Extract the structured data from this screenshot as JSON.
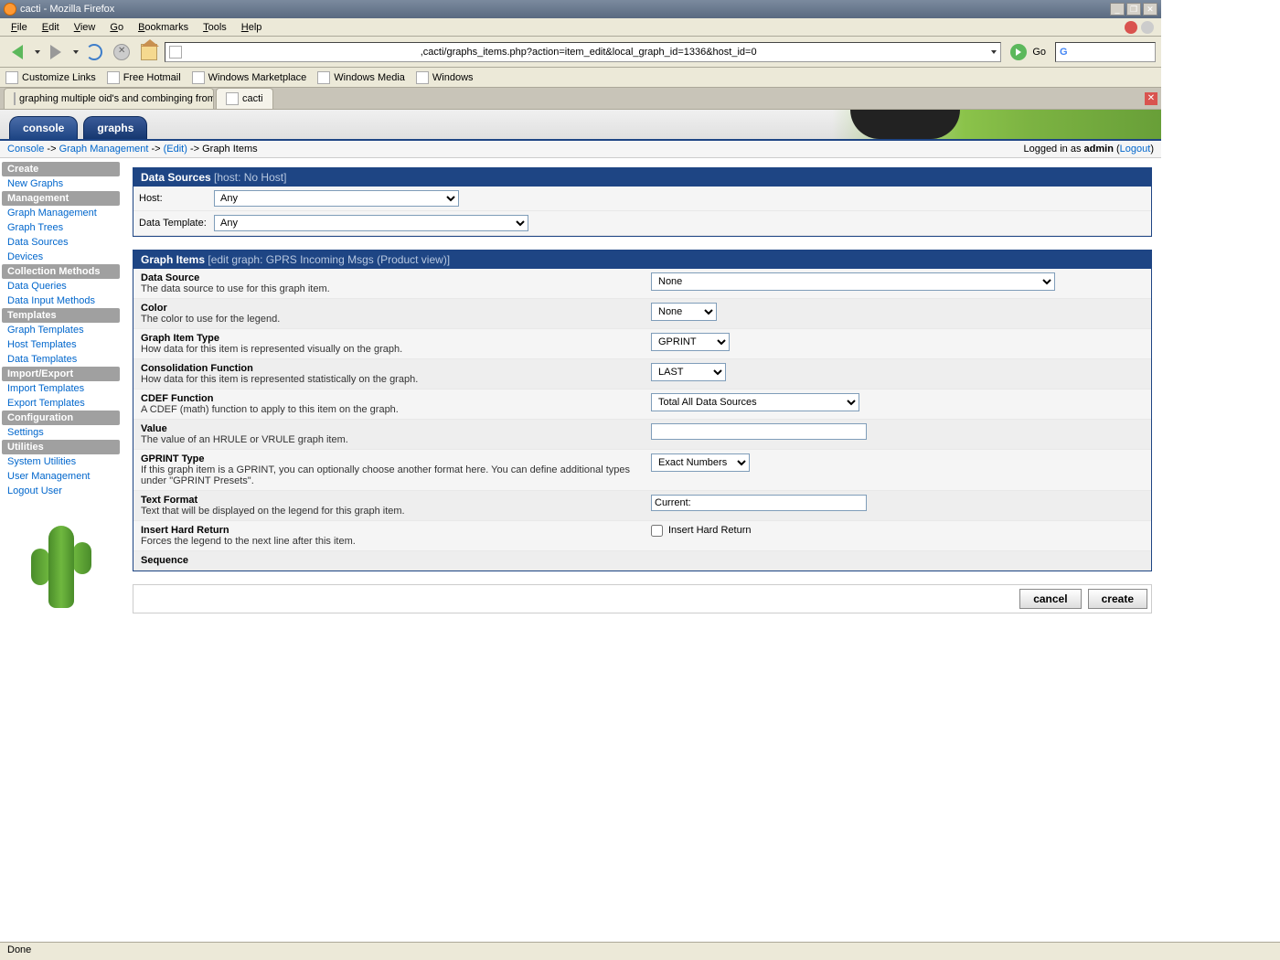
{
  "window": {
    "title": "cacti - Mozilla Firefox"
  },
  "menubar": {
    "file": "File",
    "edit": "Edit",
    "view": "View",
    "go": "Go",
    "bookmarks": "Bookmarks",
    "tools": "Tools",
    "help": "Help"
  },
  "urlbar": {
    "url": ",cacti/graphs_items.php?action=item_edit&local_graph_id=1336&host_id=0",
    "go": "Go"
  },
  "bookmarks": {
    "b0": "Customize Links",
    "b1": "Free Hotmail",
    "b2": "Windows Marketplace",
    "b3": "Windows Media",
    "b4": "Windows"
  },
  "tabs": {
    "t0": "graphing multiple oid's and combinging from...",
    "t1": "cacti"
  },
  "app_tabs": {
    "console": "console",
    "graphs": "graphs"
  },
  "breadcrumb": {
    "c0": "Console",
    "s0": " -> ",
    "c1": "Graph Management",
    "s1": " -> ",
    "c2": "(Edit)",
    "s2": " -> ",
    "c3": "Graph Items"
  },
  "login": {
    "prefix": "Logged in as ",
    "user": "admin",
    "logout": "Logout"
  },
  "sidebar": {
    "h0": "Create",
    "l0": "New Graphs",
    "h1": "Management",
    "l1": "Graph Management",
    "l2": "Graph Trees",
    "l3": "Data Sources",
    "l4": "Devices",
    "h2": "Collection Methods",
    "l5": "Data Queries",
    "l6": "Data Input Methods",
    "h3": "Templates",
    "l7": "Graph Templates",
    "l8": "Host Templates",
    "l9": "Data Templates",
    "h4": "Import/Export",
    "l10": "Import Templates",
    "l11": "Export Templates",
    "h5": "Configuration",
    "l12": "Settings",
    "h6": "Utilities",
    "l13": "System Utilities",
    "l14": "User Management",
    "l15": "Logout User"
  },
  "ds_panel": {
    "title": "Data Sources",
    "sub": "[host: No Host]",
    "host_label": "Host:",
    "host_value": "Any",
    "tmpl_label": "Data Template:",
    "tmpl_value": "Any"
  },
  "gi_panel": {
    "title": "Graph Items",
    "sub": "[edit graph:            GPRS Incoming Msgs (Product view)]",
    "r0t": "Data Source",
    "r0d": "The data source to use for this graph item.",
    "r0v": "None",
    "r1t": "Color",
    "r1d": "The color to use for the legend.",
    "r1v": "None",
    "r2t": "Graph Item Type",
    "r2d": "How data for this item is represented visually on the graph.",
    "r2v": "GPRINT",
    "r3t": "Consolidation Function",
    "r3d": "How data for this item is represented statistically on the graph.",
    "r3v": "LAST",
    "r4t": "CDEF Function",
    "r4d": "A CDEF (math) function to apply to this item on the graph.",
    "r4v": "Total All Data Sources",
    "r5t": "Value",
    "r5d": "The value of an HRULE or VRULE graph item.",
    "r5v": "",
    "r6t": "GPRINT Type",
    "r6d": "If this graph item is a GPRINT, you can optionally choose another format here. You can define additional types under \"GPRINT Presets\".",
    "r6v": "Exact Numbers",
    "r7t": "Text Format",
    "r7d": "Text that will be displayed on the legend for this graph item.",
    "r7v": "Current:",
    "r8t": "Insert Hard Return",
    "r8d": "Forces the legend to the next line after this item.",
    "r8v": "Insert Hard Return",
    "r9t": "Sequence"
  },
  "buttons": {
    "cancel": "cancel",
    "create": "create"
  },
  "status": {
    "text": "Done"
  }
}
